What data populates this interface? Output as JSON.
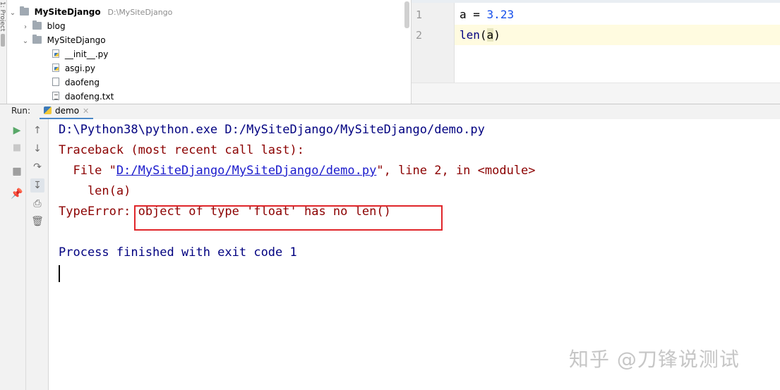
{
  "left_strip": {
    "label": "1: Project"
  },
  "project_tree": {
    "root": {
      "name": "MySiteDjango",
      "path": "D:\\MySiteDjango"
    },
    "items": [
      {
        "name": "blog",
        "type": "folder",
        "expanded": false
      },
      {
        "name": "MySiteDjango",
        "type": "folder",
        "expanded": true
      },
      {
        "name": "__init__.py",
        "type": "python-file"
      },
      {
        "name": "asgi.py",
        "type": "python-file"
      },
      {
        "name": "daofeng",
        "type": "file"
      },
      {
        "name": "daofeng.txt",
        "type": "text-file"
      }
    ]
  },
  "editor": {
    "line_numbers": [
      "1",
      "2"
    ],
    "lines": [
      {
        "var": "a",
        "op": " = ",
        "value": "3.23"
      },
      {
        "func": "len",
        "open": "(",
        "arg": "a",
        "close": ")"
      }
    ]
  },
  "run": {
    "label": "Run:",
    "tab": "demo"
  },
  "console": {
    "command": "D:\\Python38\\python.exe D:/MySiteDjango/MySiteDjango/demo.py",
    "traceback": "Traceback (most recent call last):",
    "file_prefix": "  File \"",
    "file_link": "D:/MySiteDjango/MySiteDjango/demo.py",
    "file_suffix": "\", line 2, in <module>",
    "code": "    len(a)",
    "error": "TypeError: object of type 'float' has no len()",
    "exit": "Process finished with exit code 1"
  },
  "watermark": "知乎 @刀锋说测试",
  "colors": {
    "error_text": "#8b0000",
    "command_text": "#000080",
    "link": "#1a1acc",
    "highlight_box": "#e0262a",
    "number": "#1750eb"
  },
  "icons": {
    "toolbar_left": [
      "run-icon",
      "stop-icon",
      "layout-icon",
      "pin-icon"
    ],
    "toolbar_right": [
      "arrow-up-icon",
      "arrow-down-icon",
      "soft-wrap-icon",
      "scroll-to-end-icon",
      "print-icon",
      "trash-icon"
    ]
  }
}
